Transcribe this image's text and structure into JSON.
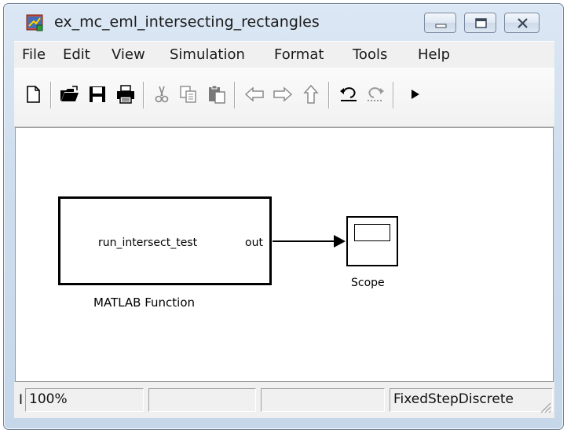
{
  "window": {
    "title": "ex_mc_eml_intersecting_rectangles",
    "app_icon": "simulink-model-icon",
    "controls": [
      "minimize-icon",
      "maximize-icon",
      "close-icon"
    ]
  },
  "menubar": {
    "items": [
      "File",
      "Edit",
      "View",
      "Simulation",
      "Format",
      "Tools",
      "Help"
    ]
  },
  "toolbar": {
    "icons": [
      "new-document-icon",
      "open-folder-icon",
      "save-icon",
      "print-icon",
      "cut-icon",
      "copy-icon",
      "paste-icon",
      "back-arrow-icon",
      "forward-arrow-icon",
      "up-arrow-icon",
      "undo-icon",
      "redo-icon",
      "play-icon"
    ]
  },
  "model": {
    "function_block": {
      "input_text": "run_intersect_test",
      "output_port": "out",
      "caption": "MATLAB Function"
    },
    "scope_block": {
      "caption": "Scope"
    }
  },
  "statusbar": {
    "truncated": "I",
    "zoom": "100%",
    "field2": "",
    "field3": "",
    "solver": "FixedStepDiscrete"
  }
}
